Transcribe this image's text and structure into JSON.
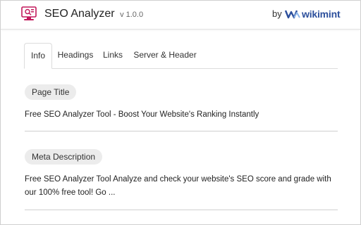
{
  "header": {
    "title": "SEO Analyzer",
    "version": "v 1.0.0",
    "by": "by",
    "brand": "wikimint",
    "brand_color": "#2c4f9c",
    "logo_color": "#c2185b",
    "logo_icon": "seo-analyzer-logo-icon"
  },
  "tabs": [
    {
      "label": "Info",
      "active": true
    },
    {
      "label": "Headings",
      "active": false
    },
    {
      "label": "Links",
      "active": false
    },
    {
      "label": "Server & Header",
      "active": false
    }
  ],
  "sections": [
    {
      "label": "Page Title",
      "text": "Free SEO Analyzer Tool - Boost Your Website's Ranking Instantly"
    },
    {
      "label": "Meta Description",
      "text": "Free SEO Analyzer Tool Analyze and check your website's SEO score and grade with our 100% free tool! Go ..."
    }
  ]
}
